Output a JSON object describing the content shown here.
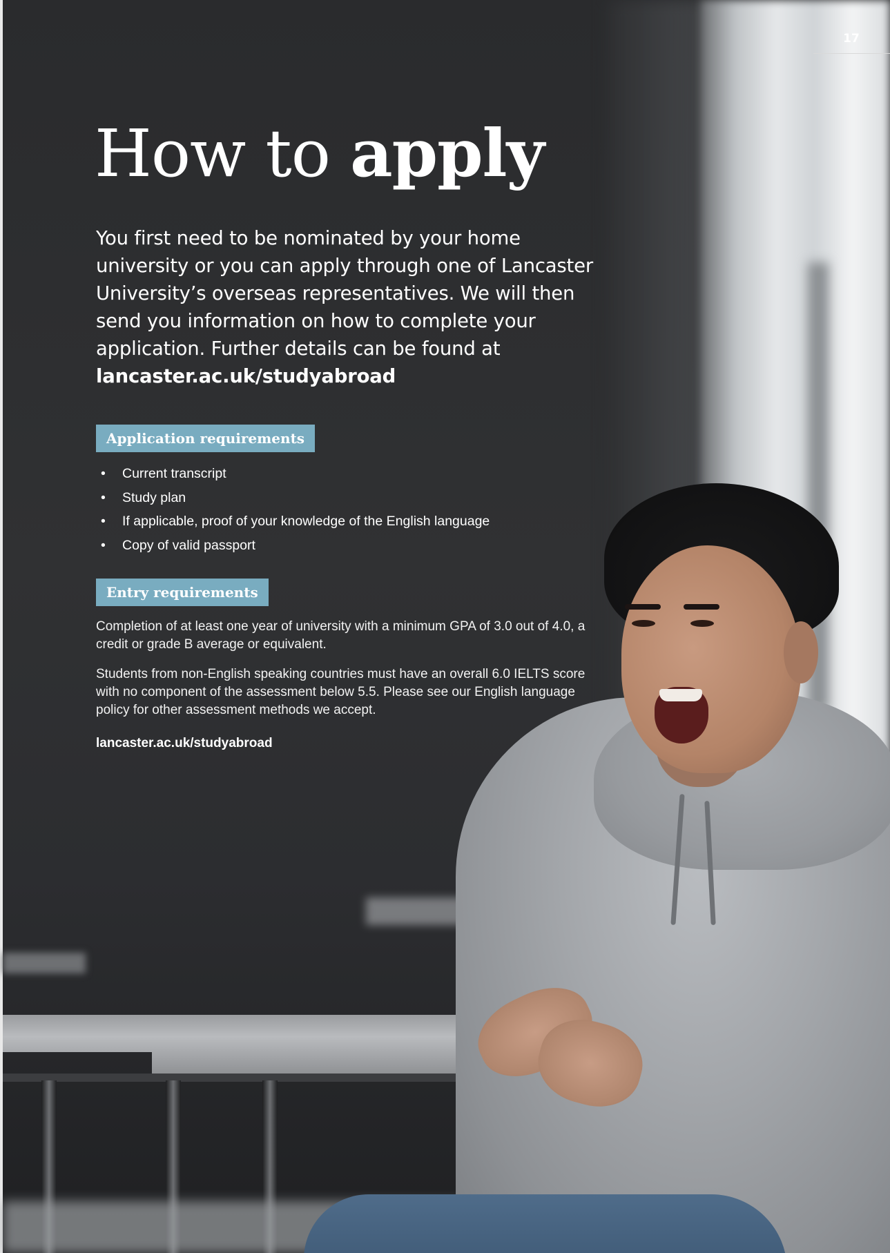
{
  "page_number": "17",
  "title": {
    "part1": "How to ",
    "part2": "apply"
  },
  "intro": {
    "text": "You first need to be nominated by your home university or you can apply through one of Lancaster University’s overseas representatives. We will then send you information on how to complete your application. Further details can be found at ",
    "link": "lancaster.ac.uk/studyabroad"
  },
  "application_requirements": {
    "heading": "Application requirements",
    "bullet": "•",
    "items": [
      "Current transcript",
      "Study plan",
      "If applicable, proof of your knowledge of the English language",
      "Copy of valid passport"
    ]
  },
  "entry_requirements": {
    "heading": "Entry requirements",
    "paragraph1": "Completion of at least one year of university with a minimum GPA of 3.0 out of 4.0, a credit or grade B average or equivalent.",
    "paragraph2": "Students from non-English speaking countries must have an overall 6.0 IELTS score with no component of the assessment below 5.5. Please see our English language policy for other assessment methods we accept.",
    "link": "lancaster.ac.uk/studyabroad"
  },
  "colors": {
    "label_background": "#79acc0",
    "page_background": "#2f3032"
  },
  "image": {
    "description_icon": "photo-student-laughing-icon"
  }
}
